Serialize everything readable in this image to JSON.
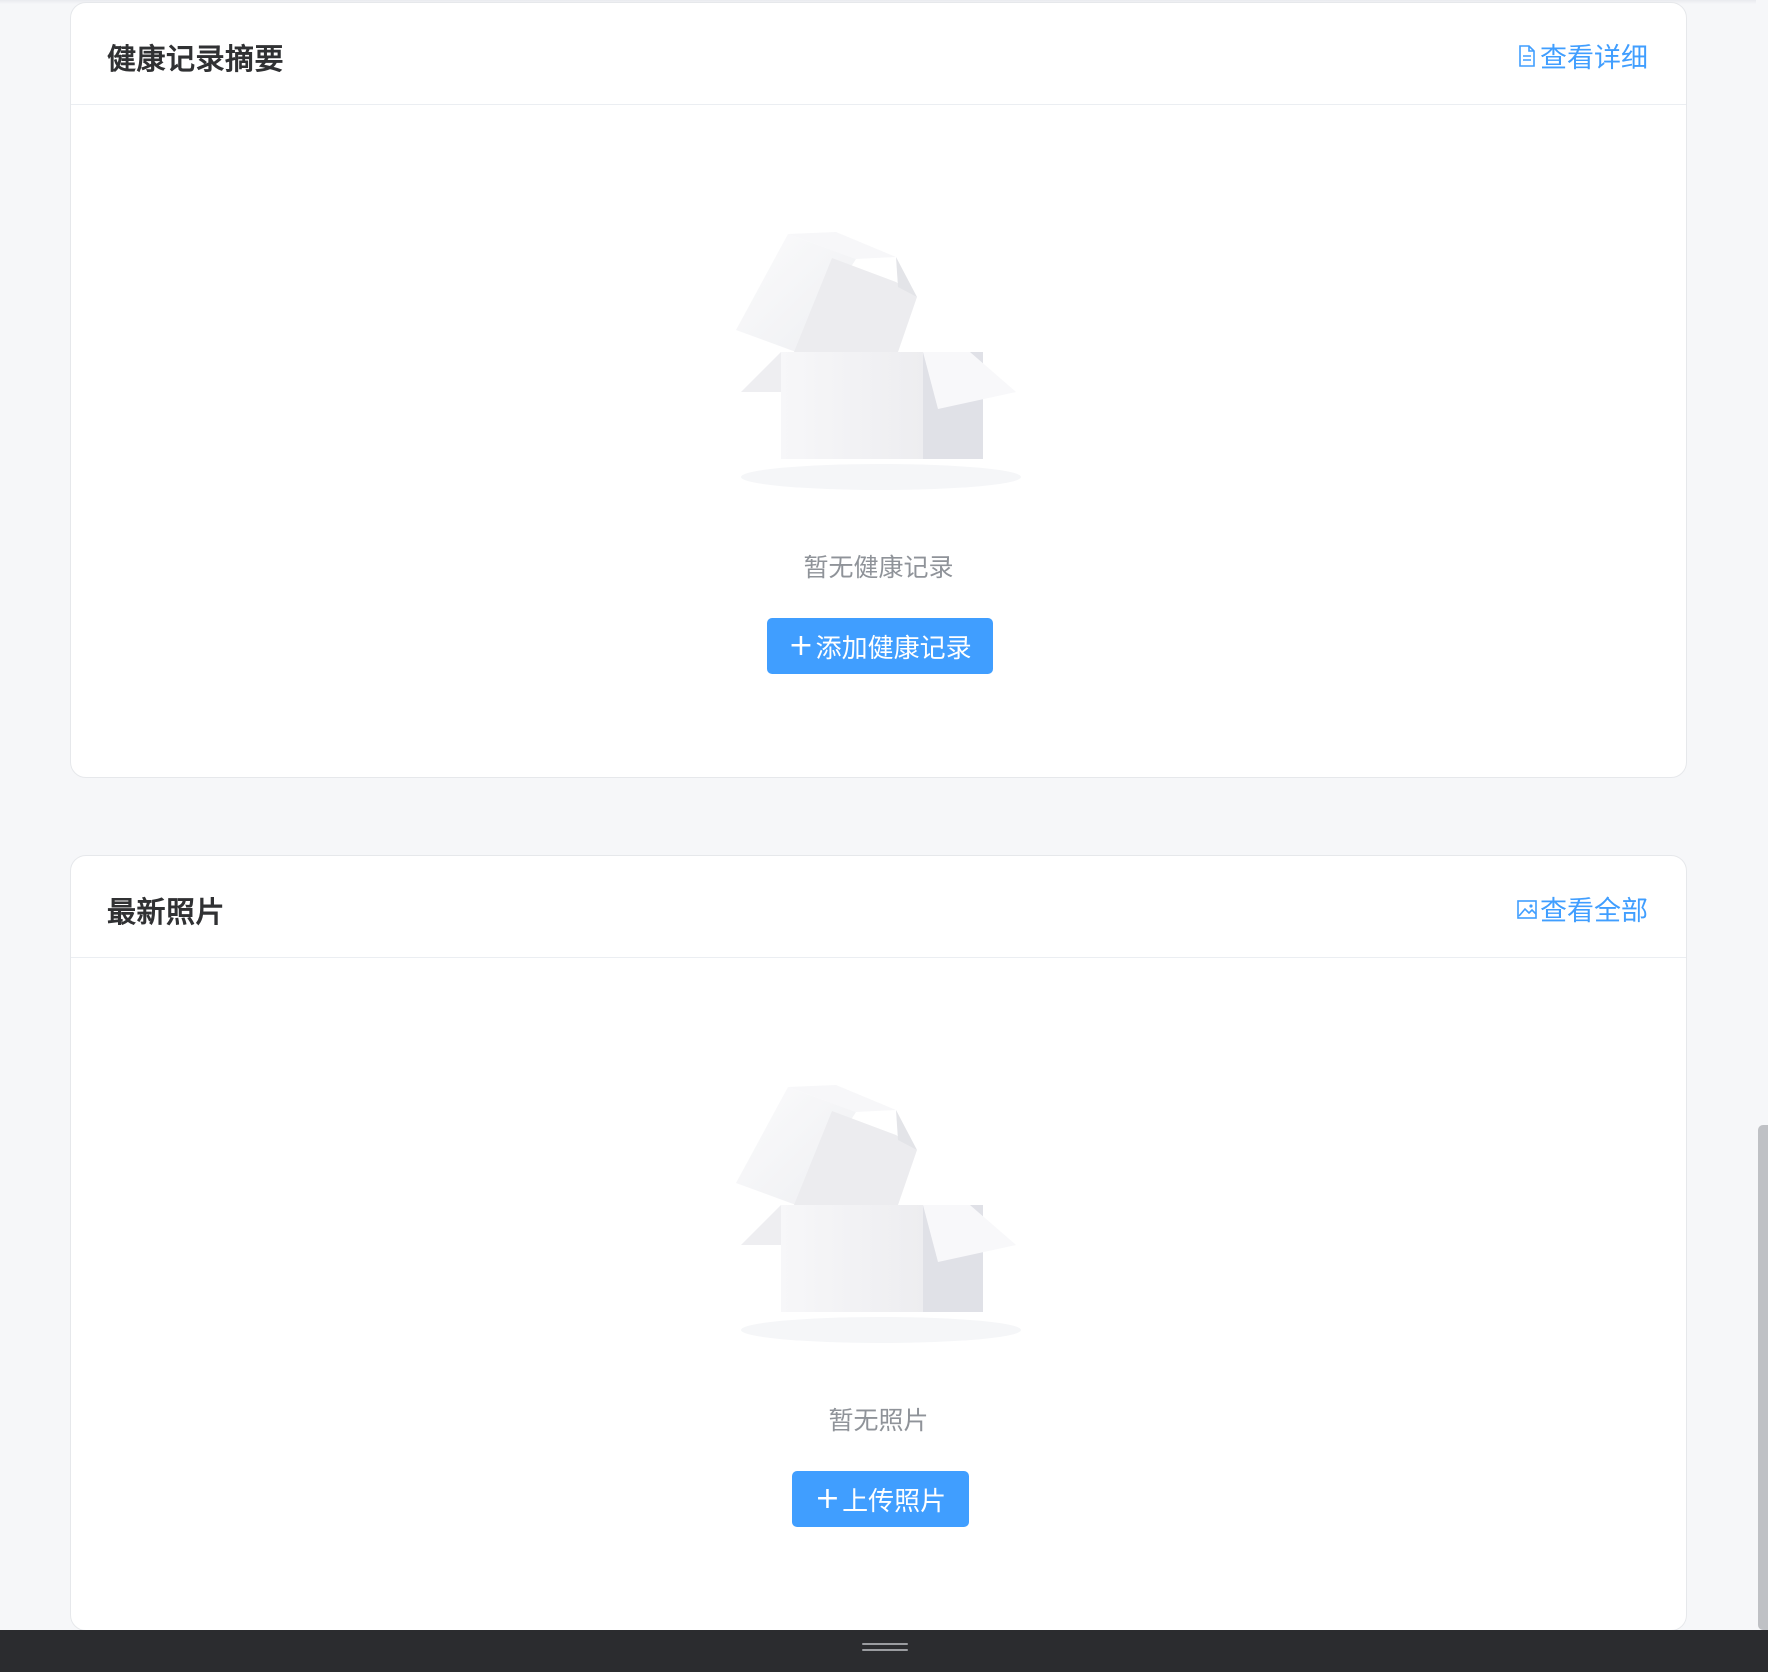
{
  "health_summary": {
    "title": "健康记录摘要",
    "link_label": "查看详细",
    "link_icon": "document-icon",
    "empty_text": "暂无健康记录",
    "button_label": "添加健康记录",
    "button_icon": "plus-icon"
  },
  "latest_photos": {
    "title": "最新照片",
    "link_label": "查看全部",
    "link_icon": "image-icon",
    "empty_text": "暂无照片",
    "button_label": "上传照片",
    "button_icon": "plus-icon"
  },
  "colors": {
    "accent": "#409eff",
    "background": "#f6f7f9",
    "card": "#ffffff",
    "title_text": "#303133",
    "muted_text": "#8f9399",
    "bottom_bar": "#2b2c2f"
  }
}
